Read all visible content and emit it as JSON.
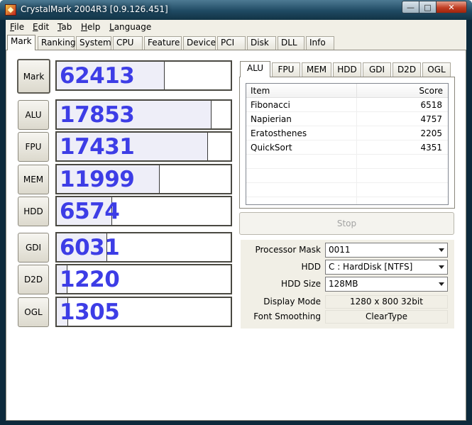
{
  "window": {
    "title": "CrystalMark 2004R3 [0.9.126.451]"
  },
  "menu": [
    {
      "key": "F",
      "rest": "ile"
    },
    {
      "key": "E",
      "rest": "dit"
    },
    {
      "key": "T",
      "rest": "ab"
    },
    {
      "key": "H",
      "rest": "elp"
    },
    {
      "key": "L",
      "rest": "anguage"
    }
  ],
  "tabs": [
    "Mark",
    "Ranking",
    "System",
    "CPU",
    "Feature",
    "Device",
    "PCI",
    "Disk",
    "DLL",
    "Info"
  ],
  "active_tab": "Mark",
  "scores": [
    {
      "label": "Mark",
      "value": "62413"
    },
    {
      "label": "ALU",
      "value": "17853"
    },
    {
      "label": "FPU",
      "value": "17431"
    },
    {
      "label": "MEM",
      "value": "11999"
    },
    {
      "label": "HDD",
      "value": "6574"
    },
    {
      "label": "GDI",
      "value": "6031"
    },
    {
      "label": "D2D",
      "value": "1220"
    },
    {
      "label": "OGL",
      "value": "1305"
    }
  ],
  "score_fill_fraction": [
    0.62,
    0.89,
    0.87,
    0.59,
    0.32,
    0.29,
    0.06,
    0.065
  ],
  "subtabs": [
    "ALU",
    "FPU",
    "MEM",
    "HDD",
    "GDI",
    "D2D",
    "OGL"
  ],
  "active_subtab": "ALU",
  "result_list": {
    "columns": [
      "Item",
      "Score"
    ],
    "rows": [
      [
        "Fibonacci",
        "6518"
      ],
      [
        "Napierian",
        "4757"
      ],
      [
        "Eratosthenes",
        "2205"
      ],
      [
        "QuickSort",
        "4351"
      ]
    ]
  },
  "stop_label": "Stop",
  "settings": {
    "processor_mask_label": "Processor Mask",
    "processor_mask_value": "0011",
    "hdd_label": "HDD",
    "hdd_value": "C : HardDisk [NTFS]",
    "hdd_size_label": "HDD Size",
    "hdd_size_value": "128MB",
    "display_mode_label": "Display Mode",
    "display_mode_value": "1280 x 800 32bit",
    "font_smoothing_label": "Font Smoothing",
    "font_smoothing_value": "ClearType"
  },
  "colors": {
    "score_text": "#3d3de6",
    "score_fill": "#eeeef8",
    "title_bar": "#1f4a63"
  }
}
